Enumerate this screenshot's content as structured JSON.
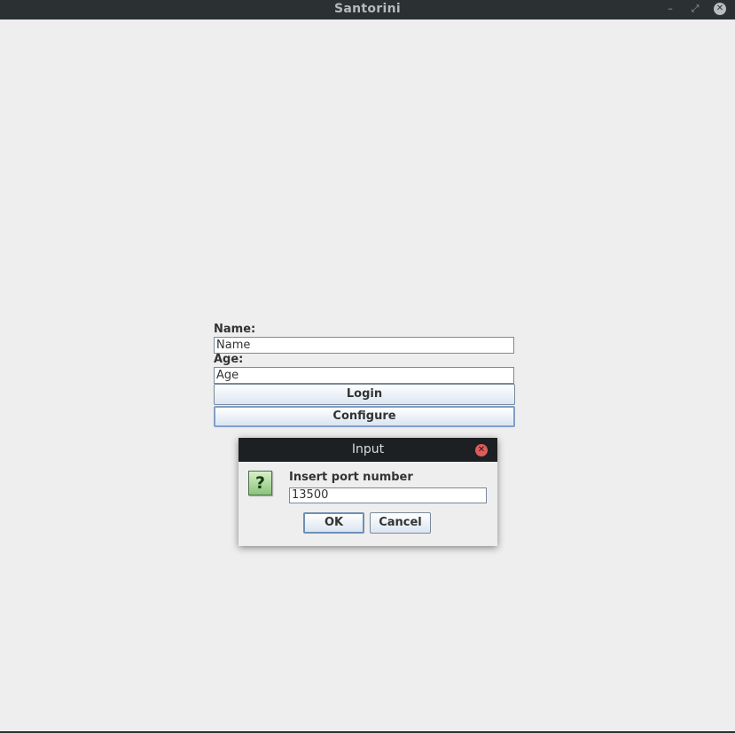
{
  "window": {
    "title": "Santorini",
    "minimize_glyph": "–",
    "maximize_glyph": "⤢",
    "close_glyph": "✕"
  },
  "form": {
    "name_label": "Name:",
    "name_value": "Name",
    "age_label": "Age:",
    "age_value": "Age",
    "login_label": "Login",
    "configure_label": "Configure"
  },
  "dialog": {
    "title": "Input",
    "close_glyph": "✕",
    "icon_glyph": "?",
    "icon_name": "question-icon",
    "prompt": "Insert port number",
    "input_value": "13500",
    "ok_label": "OK",
    "cancel_label": "Cancel"
  }
}
